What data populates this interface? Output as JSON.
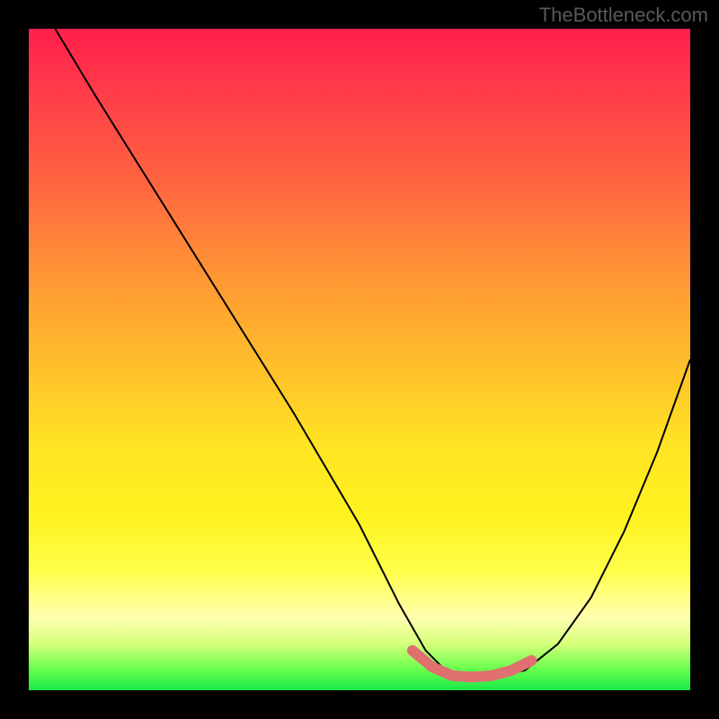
{
  "watermark": "TheBottleneck.com",
  "chart_data": {
    "type": "line",
    "title": "",
    "xlabel": "",
    "ylabel": "",
    "xlim": [
      0,
      100
    ],
    "ylim": [
      0,
      100
    ],
    "grid": false,
    "legend": false,
    "background_gradient": {
      "direction": "vertical",
      "stops": [
        {
          "pos": 0.0,
          "color": "#ff1f4b"
        },
        {
          "pos": 0.25,
          "color": "#ff6a3f"
        },
        {
          "pos": 0.52,
          "color": "#ffc22a"
        },
        {
          "pos": 0.74,
          "color": "#fff31f"
        },
        {
          "pos": 0.93,
          "color": "#d5ff7a"
        },
        {
          "pos": 1.0,
          "color": "#19e84a"
        }
      ]
    },
    "series": [
      {
        "name": "bottleneck-curve",
        "x": [
          4,
          10,
          20,
          30,
          40,
          50,
          56,
          60,
          63,
          66,
          70,
          75,
          80,
          85,
          90,
          95,
          100
        ],
        "y": [
          100,
          90,
          74,
          58,
          42,
          25,
          13,
          6,
          3,
          2,
          2,
          3,
          7,
          14,
          24,
          36,
          50
        ]
      }
    ],
    "highlight_segment": {
      "note": "pink trough marker along curve bottom",
      "x": [
        58,
        61,
        64,
        67,
        70,
        73,
        76
      ],
      "y": [
        6,
        3.5,
        2.2,
        2,
        2.2,
        3,
        4.5
      ]
    }
  }
}
